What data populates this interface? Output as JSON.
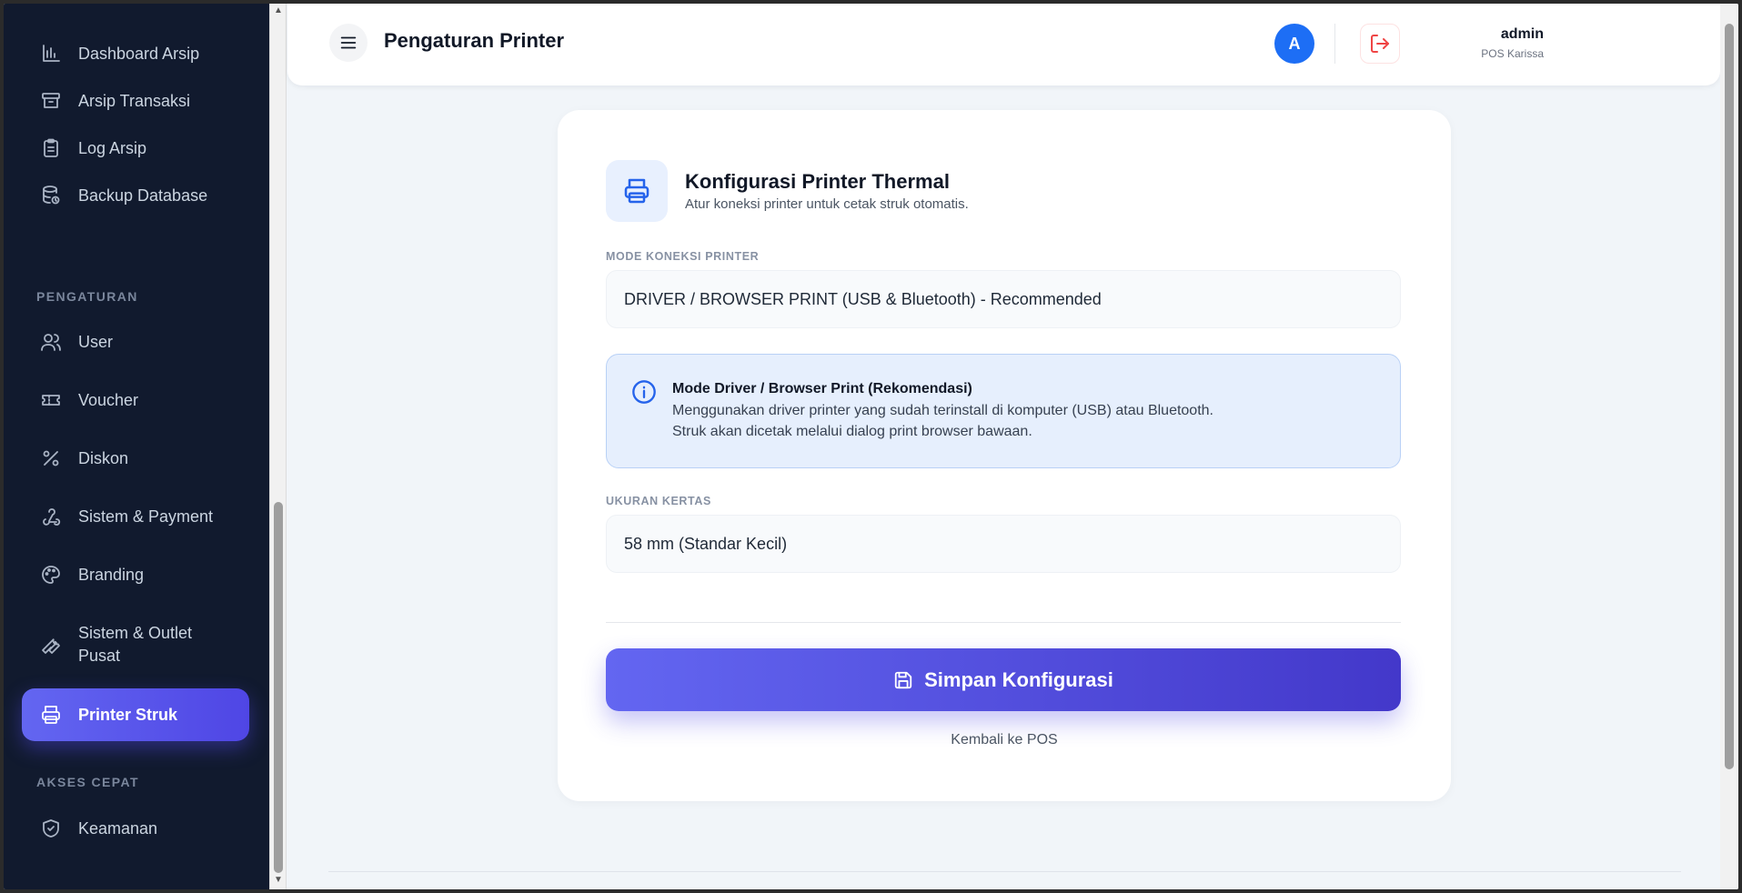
{
  "sidebar": {
    "items": [
      {
        "label": "Dashboard Arsip",
        "icon": "bar-chart-icon"
      },
      {
        "label": "Arsip Transaksi",
        "icon": "archive-icon"
      },
      {
        "label": "Log Arsip",
        "icon": "clipboard-list-icon"
      },
      {
        "label": "Backup Database",
        "icon": "database-backup-icon"
      }
    ],
    "section_pengaturan": "PENGATURAN",
    "settings_items": [
      {
        "label": "User",
        "icon": "users-icon"
      },
      {
        "label": "Voucher",
        "icon": "ticket-icon"
      },
      {
        "label": "Diskon",
        "icon": "percent-icon"
      },
      {
        "label": "Sistem & Payment",
        "icon": "webhook-icon"
      },
      {
        "label": "Branding",
        "icon": "palette-icon"
      },
      {
        "label": "Sistem & Outlet Pusat",
        "icon": "wrench-icon"
      },
      {
        "label": "Printer Struk",
        "icon": "printer-icon",
        "active": true
      }
    ],
    "section_akses": "AKSES CEPAT",
    "quick_items": [
      {
        "label": "Keamanan",
        "icon": "shield-check-icon"
      }
    ]
  },
  "header": {
    "title": "Pengaturan Printer",
    "user_name": "admin",
    "user_role": "POS Karissa",
    "avatar_initial": "A"
  },
  "card": {
    "title": "Konfigurasi Printer Thermal",
    "subtitle": "Atur koneksi printer untuk cetak struk otomatis.",
    "mode_label": "MODE KONEKSI PRINTER",
    "mode_value": "DRIVER / BROWSER PRINT (USB & Bluetooth) - Recommended",
    "info_title": "Mode Driver / Browser Print (Rekomendasi)",
    "info_line1": "Menggunakan driver printer yang sudah terinstall di komputer (USB) atau Bluetooth.",
    "info_line2": "Struk akan dicetak melalui dialog print browser bawaan.",
    "paper_label": "UKURAN KERTAS",
    "paper_value": "58 mm (Standar Kecil)",
    "save_label": "Simpan Konfigurasi",
    "back_label": "Kembali ke POS"
  },
  "colors": {
    "sidebar_bg": "#111a2e",
    "accent": "#4f46e5",
    "avatar": "#1d6ef5",
    "info_bg": "#e6effd",
    "logout": "#ef4444"
  }
}
